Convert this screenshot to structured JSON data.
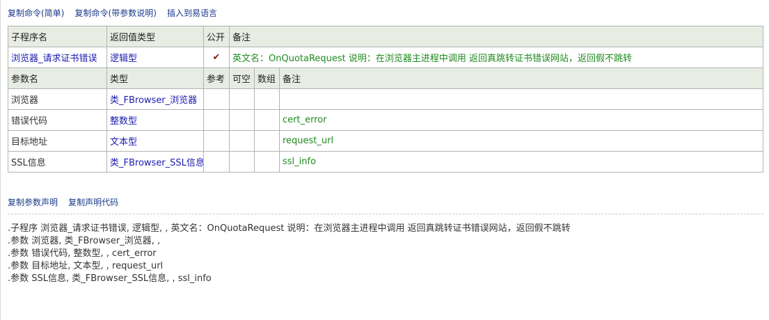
{
  "top_links": [
    "复制命令(简单)",
    "复制命令(带参数说明)",
    "插入到易语言"
  ],
  "header": {
    "sub_name_label": "子程序名",
    "return_type_label": "返回值类型",
    "public_label": "公开",
    "remark_label": "备注"
  },
  "command": {
    "name": "浏览器_请求证书错误",
    "return_type": "逻辑型",
    "public_mark": "✔",
    "remark": "英文名：OnQuotaRequest 说明：在浏览器主进程中调用 返回真跳转证书错误网站，返回假不跳转"
  },
  "param_header": {
    "name_label": "参数名",
    "type_label": "类型",
    "ref_label": "参考",
    "nullable_label": "可空",
    "array_label": "数组",
    "remark_label": "备注"
  },
  "params": [
    {
      "name": "浏览器",
      "type": "类_FBrowser_浏览器",
      "remark": ""
    },
    {
      "name": "错误代码",
      "type": "整数型",
      "remark": "cert_error"
    },
    {
      "name": "目标地址",
      "type": "文本型",
      "remark": "request_url"
    },
    {
      "name": "SSL信息",
      "type": "类_FBrowser_SSL信息",
      "remark": "ssl_info"
    }
  ],
  "mid_links": [
    "复制参数声明",
    "复制声明代码"
  ],
  "code_lines": [
    ".子程序 浏览器_请求证书错误, 逻辑型, , 英文名：OnQuotaRequest 说明：在浏览器主进程中调用 返回真跳转证书错误网站，返回假不跳转",
    ".参数 浏览器, 类_FBrowser_浏览器, ,",
    ".参数 错误代码, 整数型, , cert_error",
    ".参数 目标地址, 文本型, , request_url",
    ".参数 SSL信息, 类_FBrowser_SSL信息, , ssl_info"
  ]
}
